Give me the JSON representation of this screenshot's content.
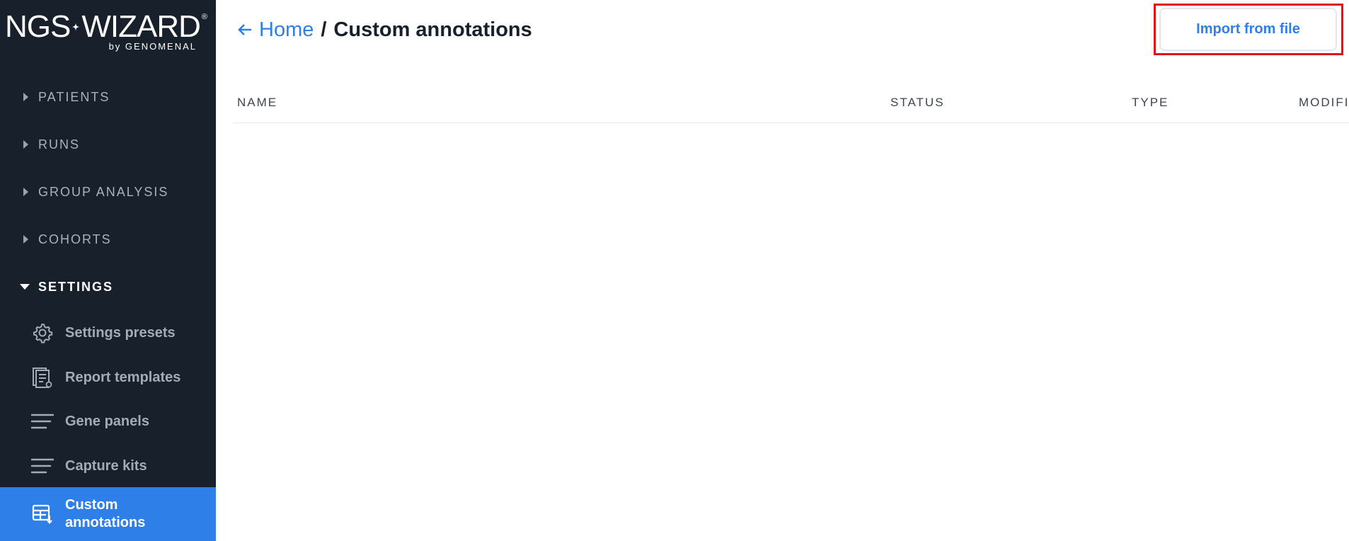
{
  "logo": {
    "main_left": "NGS",
    "main_right": "WIZARD",
    "registered": "®",
    "sub": "by GENOMENAL"
  },
  "sidebar": {
    "groups": [
      {
        "label": "PATIENTS",
        "expanded": false
      },
      {
        "label": "RUNS",
        "expanded": false
      },
      {
        "label": "GROUP ANALYSIS",
        "expanded": false
      },
      {
        "label": "COHORTS",
        "expanded": false
      },
      {
        "label": "SETTINGS",
        "expanded": true
      }
    ],
    "settings_items": [
      {
        "label": "Settings presets",
        "icon": "gear-icon"
      },
      {
        "label": "Report templates",
        "icon": "report-template-icon"
      },
      {
        "label": "Gene panels",
        "icon": "lines-icon"
      },
      {
        "label": "Capture kits",
        "icon": "lines-icon"
      },
      {
        "label": "Custom annotations",
        "icon": "table-import-icon",
        "active": true
      }
    ]
  },
  "header": {
    "back_label": "Home",
    "separator": "/",
    "current": "Custom annotations",
    "import_button": "Import from file"
  },
  "table": {
    "columns": [
      "NAME",
      "STATUS",
      "TYPE",
      "MODIFIED"
    ],
    "rows": []
  },
  "colors": {
    "sidebar_bg": "#17202b",
    "accent": "#2e7fe8",
    "highlight": "#e0121a"
  }
}
